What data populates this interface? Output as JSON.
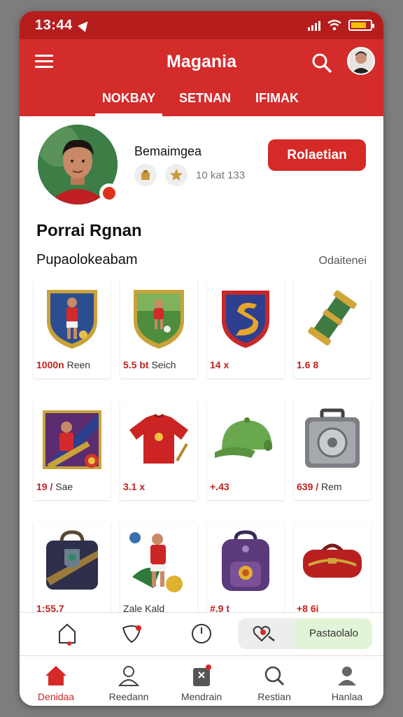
{
  "status_bar": {
    "time": "13:44"
  },
  "header": {
    "title": "Magania",
    "tabs": [
      {
        "label": "NOKBAY",
        "active": true
      },
      {
        "label": "SETNAN",
        "active": false
      },
      {
        "label": "IFIMAK",
        "active": false
      }
    ]
  },
  "profile": {
    "name": "Bemaimgea",
    "stats": "10 kat 133",
    "button_label": "Rolaetian"
  },
  "section": {
    "title": "Porrai Rgnan",
    "subtitle": "Pupaolokeabam",
    "see_all": "Odaitenei"
  },
  "items": [
    {
      "icon": "player-badge-icon",
      "price": "1000n",
      "unit": "Reen"
    },
    {
      "icon": "crest-badge-icon",
      "price": "5.5 bt",
      "unit": "Seich"
    },
    {
      "icon": "shield-icon",
      "price": "14 x",
      "unit": ""
    },
    {
      "icon": "trophy-scroll-icon",
      "price": "1.6 8",
      "unit": ""
    },
    {
      "icon": "player-card-icon",
      "price": "19 /",
      "unit": "Sae"
    },
    {
      "icon": "jersey-icon",
      "price": "3.1 x",
      "unit": ""
    },
    {
      "icon": "cap-icon",
      "price": "+.43",
      "unit": ""
    },
    {
      "icon": "safe-box-icon",
      "price": "639 /",
      "unit": "Rem"
    },
    {
      "icon": "bag-icon",
      "price": "1:55.7",
      "unit": ""
    },
    {
      "icon": "player-figure-icon",
      "price": "",
      "unit": "Zale Kald"
    },
    {
      "icon": "backpack-icon",
      "price": "#.9 t",
      "unit": ""
    },
    {
      "icon": "duffel-bag-icon",
      "price": "+8 6i",
      "unit": ""
    }
  ],
  "action_row": {
    "segment_label": "Pastaolalo"
  },
  "bottom_nav": [
    {
      "label": "Denidaa",
      "icon": "home-icon",
      "active": true
    },
    {
      "label": "Reedann",
      "icon": "profile-icon",
      "active": false
    },
    {
      "label": "Mendrain",
      "icon": "pages-icon",
      "active": false
    },
    {
      "label": "Restian",
      "icon": "search-icon",
      "active": false
    },
    {
      "label": "Hanlaa",
      "icon": "user-icon",
      "active": false
    }
  ],
  "colors": {
    "brand_red": "#d42b2b",
    "status_red": "#b51d1d",
    "price_red": "#c02222",
    "segment_green": "#e2f4d8"
  }
}
